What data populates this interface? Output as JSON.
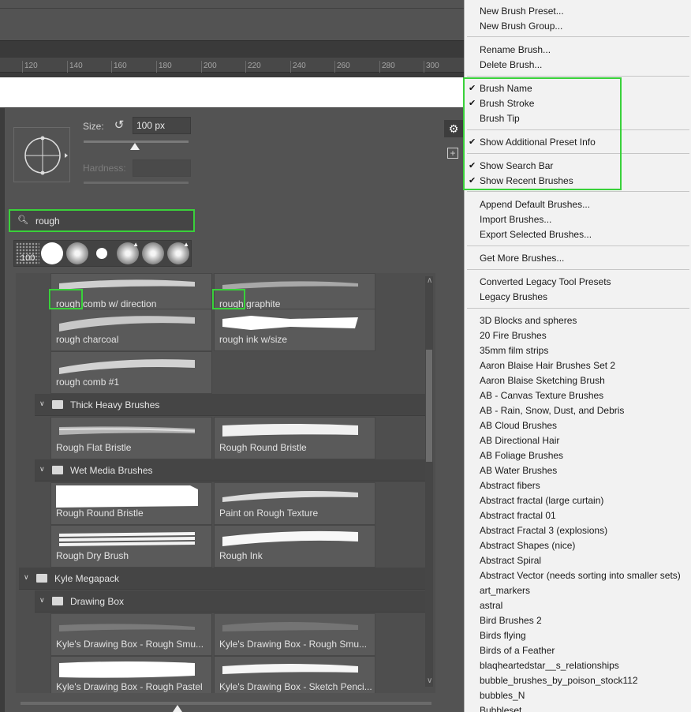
{
  "ruler": {
    "ticks": [
      "120",
      "140",
      "160",
      "180",
      "200",
      "220",
      "240",
      "260",
      "280",
      "300"
    ]
  },
  "brush_settings": {
    "size_label": "Size:",
    "size_value": "100 px",
    "hardness_label": "Hardness:"
  },
  "search": {
    "value": "rough"
  },
  "recent_brushes": {
    "first_size": "100"
  },
  "brush_tiles": [
    {
      "name_prefix": "rough",
      "name_rest": " comb w/ direction"
    },
    {
      "name_prefix": "rough",
      "name_rest": " graphite"
    },
    {
      "name": "rough charcoal"
    },
    {
      "name": "rough ink w/size"
    },
    {
      "name": "rough comb #1"
    },
    {
      "name": "Rough Flat Bristle"
    },
    {
      "name": "Rough Round Bristle"
    },
    {
      "name": "Rough Round Bristle"
    },
    {
      "name": "Paint on Rough Texture"
    },
    {
      "name": "Rough Dry Brush"
    },
    {
      "name": "Rough Ink"
    },
    {
      "name": "Kyle's Drawing Box - Rough Smu..."
    },
    {
      "name": "Kyle's Drawing Box - Rough Smu..."
    },
    {
      "name": "Kyle's Drawing Box - Rough Pastel"
    },
    {
      "name": "Kyle's Drawing Box - Sketch Penci..."
    }
  ],
  "groups": {
    "thick_heavy": "Thick Heavy Brushes",
    "wet_media": "Wet Media Brushes",
    "kyle_megapack": "Kyle Megapack",
    "drawing_box": "Drawing Box"
  },
  "menu": {
    "items": [
      {
        "label": "New Brush Preset...",
        "checked": false
      },
      {
        "label": "New Brush Group...",
        "checked": false
      },
      {
        "label": "Rename Brush...",
        "checked": false
      },
      {
        "label": "Delete Brush...",
        "checked": false
      },
      {
        "label": "Brush Name",
        "checked": true
      },
      {
        "label": "Brush Stroke",
        "checked": true
      },
      {
        "label": "Brush Tip",
        "checked": false
      },
      {
        "label": "Show Additional Preset Info",
        "checked": true
      },
      {
        "label": "Show Search Bar",
        "checked": true
      },
      {
        "label": "Show Recent Brushes",
        "checked": true
      },
      {
        "label": "Append Default Brushes...",
        "checked": false
      },
      {
        "label": "Import Brushes...",
        "checked": false
      },
      {
        "label": "Export Selected Brushes...",
        "checked": false
      },
      {
        "label": "Get More Brushes...",
        "checked": false
      },
      {
        "label": "Converted Legacy Tool Presets",
        "checked": false
      },
      {
        "label": "Legacy Brushes",
        "checked": false
      },
      {
        "label": "3D Blocks and spheres",
        "checked": false
      },
      {
        "label": "20 Fire Brushes",
        "checked": false
      },
      {
        "label": "35mm film strips",
        "checked": false
      },
      {
        "label": "Aaron Blaise Hair Brushes Set 2",
        "checked": false
      },
      {
        "label": "Aaron Blaise Sketching Brush",
        "checked": false
      },
      {
        "label": "AB - Canvas Texture Brushes",
        "checked": false
      },
      {
        "label": "AB - Rain, Snow, Dust, and Debris",
        "checked": false
      },
      {
        "label": "AB Cloud Brushes",
        "checked": false
      },
      {
        "label": "AB Directional Hair",
        "checked": false
      },
      {
        "label": "AB Foliage Brushes",
        "checked": false
      },
      {
        "label": "AB Water Brushes",
        "checked": false
      },
      {
        "label": "Abstract fibers",
        "checked": false
      },
      {
        "label": "Abstract fractal (large curtain)",
        "checked": false
      },
      {
        "label": "Abstract fractal 01",
        "checked": false
      },
      {
        "label": "Abstract Fractal 3 (explosions)",
        "checked": false
      },
      {
        "label": "Abstract Shapes (nice)",
        "checked": false
      },
      {
        "label": "Abstract Spiral",
        "checked": false
      },
      {
        "label": "Abstract Vector (needs sorting into smaller sets)",
        "checked": false
      },
      {
        "label": "art_markers",
        "checked": false
      },
      {
        "label": "astral",
        "checked": false
      },
      {
        "label": "Bird Brushes 2",
        "checked": false
      },
      {
        "label": "Birds flying",
        "checked": false
      },
      {
        "label": "Birds of a Feather",
        "checked": false
      },
      {
        "label": "blaqheartedstar__s_relationships",
        "checked": false
      },
      {
        "label": "bubble_brushes_by_poison_stock112",
        "checked": false
      },
      {
        "label": "bubbles_N",
        "checked": false
      },
      {
        "label": "Bubbleset",
        "checked": false
      }
    ]
  },
  "colors": {
    "highlight": "#39d13a",
    "panel": "#535353",
    "menu_bg": "#f2f2f2"
  },
  "icons": [
    "brush-tip-crosshair-icon",
    "reset-size-icon",
    "gear-icon",
    "new-group-icon",
    "search-icon",
    "folder-icon",
    "chevron-down-icon",
    "pressure-icon"
  ]
}
